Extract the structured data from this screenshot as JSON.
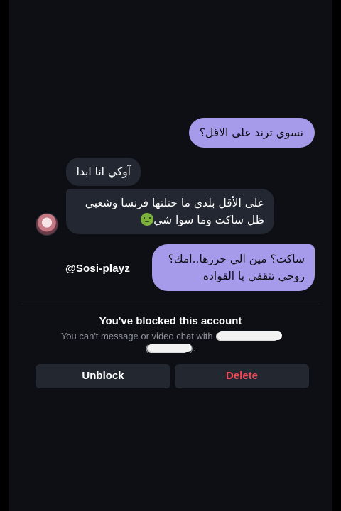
{
  "messages": [
    {
      "direction": "outgoing",
      "text": "نسوي ترند على الاقل؟"
    },
    {
      "direction": "incoming",
      "text": "آوكي انا ابدا"
    },
    {
      "direction": "incoming",
      "line1": "على الأقل بلدي ما حتلتها فرنسا وشعبي",
      "line2": "ظل ساكت وما سوا شي",
      "emoji": "nauseated-face-icon"
    },
    {
      "direction": "outgoing",
      "line1": "ساكت؟ مين الي حررها..امك؟",
      "line2": "روحي تثقفي يا القواده"
    }
  ],
  "watermark": "@Sosi-playz",
  "blocked": {
    "title": "You've blocked this account",
    "subtitle_prefix": "You can't message or video chat with",
    "subtitle_suffix": ")."
  },
  "buttons": {
    "unblock": "Unblock",
    "delete": "Delete"
  },
  "colors": {
    "outgoing_bubble": "#a69bea",
    "incoming_bubble": "#222731",
    "delete_red": "#ed4956",
    "background": "#0d0f14"
  }
}
